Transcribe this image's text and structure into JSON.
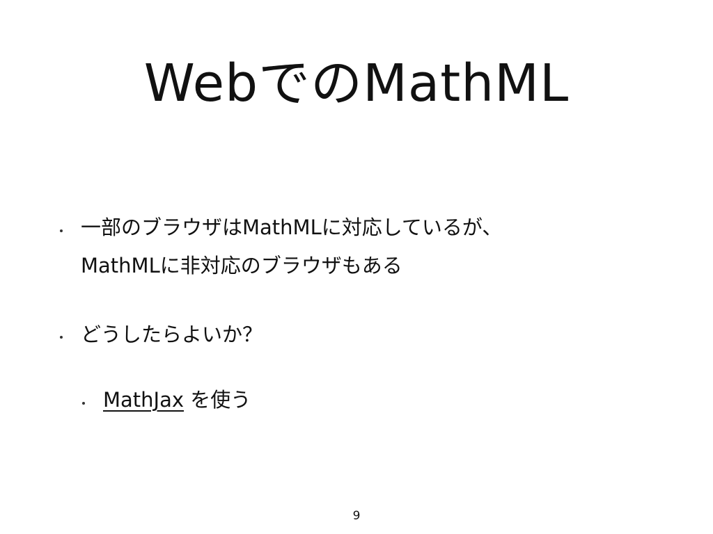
{
  "slide": {
    "title": "WebでのMathML",
    "bullets": [
      {
        "line1": "一部のブラウザはMathMLに対応しているが、",
        "line2": "MathMLに非対応のブラウザもある"
      },
      {
        "text": "どうしたらよいか？"
      }
    ],
    "sub_bullet": {
      "link_text": "MathJax",
      "rest_text": " を使う"
    },
    "page_number": "9"
  }
}
